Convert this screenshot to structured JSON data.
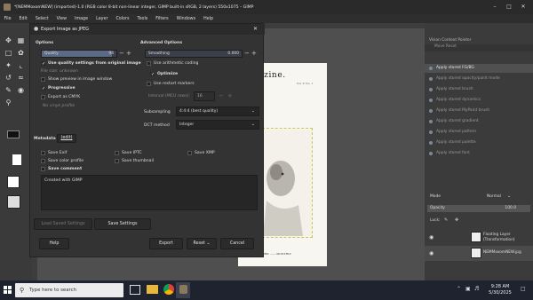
{
  "window": {
    "title": "*[NEMMoxomNEW] (imported)-1.0 (RGB color 8-bit non-linear integer, GIMP built-in sRGB, 2 layers) 550x1075 – GIMP"
  },
  "menubar": [
    "File",
    "Edit",
    "Select",
    "View",
    "Image",
    "Layer",
    "Colors",
    "Tools",
    "Filters",
    "Windows",
    "Help"
  ],
  "document": {
    "masthead": "Magazine.",
    "sub": "Vol. V. No. 1",
    "footer": "NEW-YORK: ------ MONTHLY."
  },
  "dialog": {
    "title": "Export Image as JPEG",
    "options_heading": "Options",
    "quality_label": "Quality",
    "quality_value": "94",
    "quality_fraction": 0.94,
    "use_quality_settings": "Use quality settings from original image",
    "file_size": "File size: unknown",
    "show_preview": "Show preview in image window",
    "progressive": "Progressive",
    "export_cmyk": "Export as CMYK",
    "no_profile": "No cmyk profile",
    "advanced_heading": "Advanced Options",
    "smoothing_label": "Smoothing",
    "smoothing_value": "0.000",
    "use_arithmetic": "Use arithmetic coding",
    "optimize": "Optimize",
    "use_restart": "Use restart markers",
    "interval_label": "Interval (MCU rows):",
    "interval_value": "16",
    "subsampling_label": "Subsampling",
    "subsampling_value": "4:4:4 (best quality)",
    "dct_label": "DCT method",
    "dct_value": "Integer",
    "metadata_heading": "Metadata",
    "edit_link": "(edit)",
    "save_exif": "Save Exif",
    "save_xmp": "Save XMP",
    "save_iptc": "Save IPTC",
    "save_color_profile": "Save color profile",
    "save_thumbnail": "Save thumbnail",
    "save_comment": "Save comment",
    "comment_text": "Created with GIMP",
    "load_defaults": "Load Saved Settings",
    "save_defaults": "Save Settings",
    "help": "Help",
    "export": "Export",
    "reset": "Reset",
    "cancel": "Cancel"
  },
  "history": {
    "tab": "Vision Context Pointer",
    "move_header": "Move Reset",
    "items": [
      "Apply stored FG/BG",
      "Apply stored opacity/paint mode",
      "Apply stored brush",
      "Apply stored dynamics",
      "Apply stored MyPaint brush",
      "Apply stored gradient",
      "Apply stored pattern",
      "Apply stored palette",
      "Apply stored font"
    ]
  },
  "layers": {
    "mode_label": "Mode",
    "mode_value": "Normal",
    "opacity_label": "Opacity",
    "opacity_value": "100.0",
    "lock_label": "Lock:",
    "items": [
      {
        "name": "Floating Layer (Transformation)"
      },
      {
        "name": "NEMMoxomNEW.jpg"
      }
    ]
  },
  "taskbar": {
    "search_placeholder": "Type here to search",
    "time": "9:28 AM",
    "date": "5/30/2025"
  },
  "colors": {
    "accent": "#5b6a85",
    "dialog_bg": "#333333",
    "canvas_bg": "#4f4f4f"
  }
}
